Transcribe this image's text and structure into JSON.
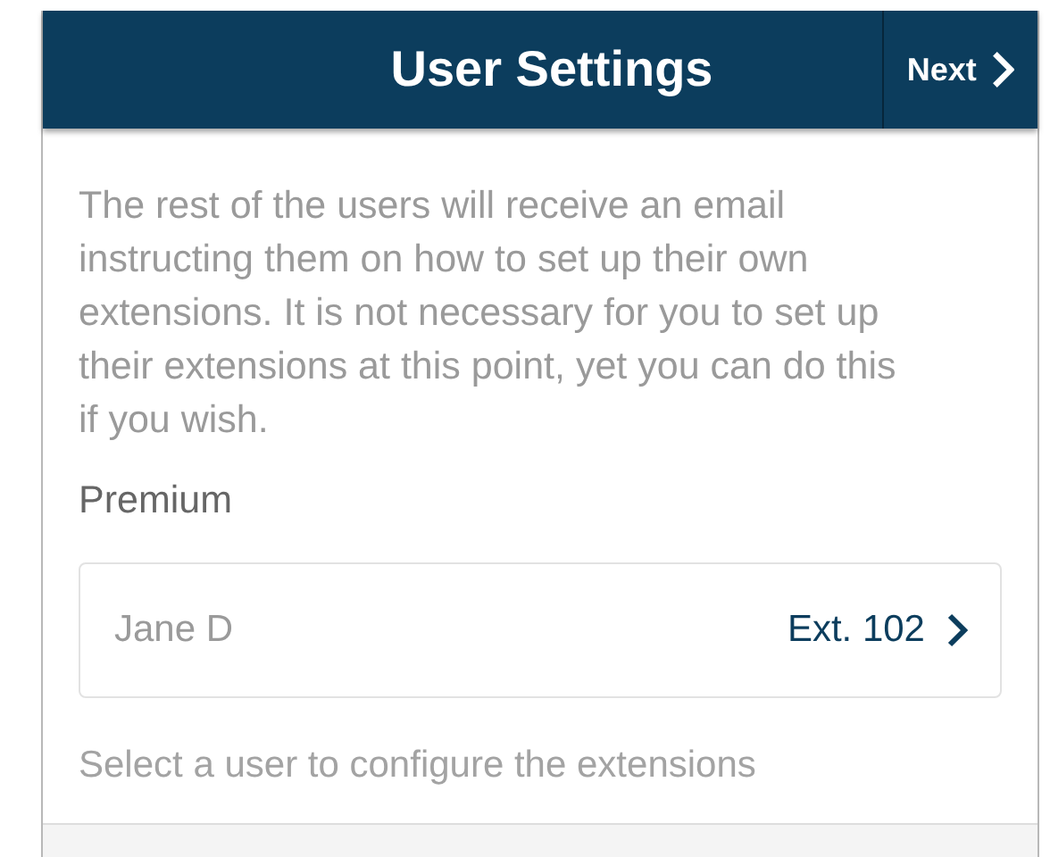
{
  "header": {
    "title": "User Settings",
    "next_button": "Next"
  },
  "intro": "The rest of the users will receive an email instructing them on how to set up their own extensions. It is not necessary for you to set up their extensions at this point, yet you can do this if you wish.",
  "section_label": "Premium",
  "users": [
    {
      "name": "Jane D",
      "extension": "Ext. 102"
    }
  ],
  "hint": "Select a user to configure the extensions"
}
